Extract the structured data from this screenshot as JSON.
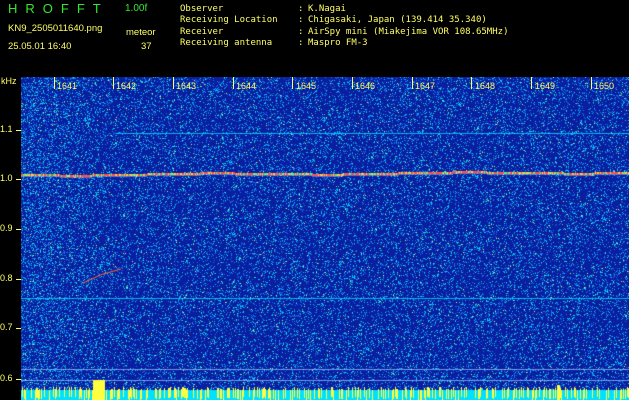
{
  "app": {
    "title": "HROFFT",
    "version": "1.00f"
  },
  "file": {
    "name": "KN9_2505011640.png",
    "datetime": "25.05.01 16:40"
  },
  "meteor": {
    "label": "meteor",
    "count": "37"
  },
  "info": [
    {
      "label": "Observer",
      "value": "K.Nagai"
    },
    {
      "label": "Receiving Location",
      "value": "Chigasaki, Japan (139.414 35.340)"
    },
    {
      "label": "Receiver",
      "value": "AirSpy mini (Miakejima VOR 108.65MHz)"
    },
    {
      "label": "Receiving antenna",
      "value": "Maspro FM-3"
    }
  ],
  "axes": {
    "y_unit": "kHz",
    "y_ticks": [
      "1.1",
      "1.0",
      "0.9",
      "0.8",
      "0.7",
      "0.6"
    ],
    "x_ticks": [
      "1641",
      "1642",
      "1643",
      "1644",
      "1645",
      "1646",
      "1647",
      "1648",
      "1649",
      "1650"
    ]
  },
  "colors": {
    "text_yellow": "#ffff66",
    "title_green": "#33e633",
    "background_dark_blue": "#0a1ea0",
    "noise_cyan": "#00d8ff",
    "carrier_line": "#ff5050"
  }
}
